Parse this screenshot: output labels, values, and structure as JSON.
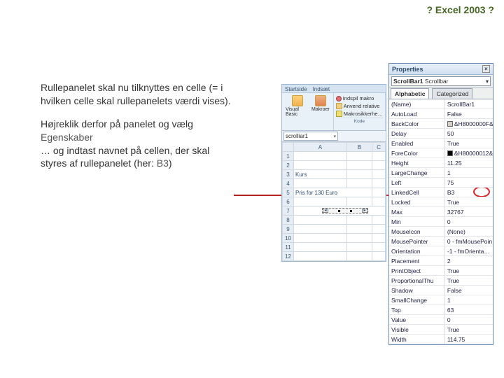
{
  "header": {
    "note": "? Excel 2003 ?"
  },
  "instructions": {
    "p1": "Rullepanelet skal nu tilknyttes en celle (= i hvilken celle skal rullepanelets værdi vises).",
    "p2a": "Højreklik derfor på panelet og vælg ",
    "p2b": "Egenskaber",
    "p3a": "… og indtast navnet på cellen, der skal styres af rullepanelet (her: ",
    "p3b": "B3",
    "p3c": ")"
  },
  "ribbon": {
    "tabs": [
      "Startside",
      "Indsæt"
    ],
    "vb": "Visual Basic",
    "mk": "Makroer",
    "rec": "Indspil makro",
    "rel": "Anvend relative",
    "sec": "Makrosikkerhe…",
    "group": "Kode"
  },
  "namebox": "scrolliar1",
  "columns": [
    "A",
    "B",
    "C"
  ],
  "rows": [
    "1",
    "2",
    "3",
    "4",
    "5",
    "6",
    "7",
    "8",
    "9",
    "10",
    "11",
    "12"
  ],
  "cells": {
    "A3": "Kurs",
    "A5": "Pris for 130 Euro"
  },
  "properties": {
    "title": "Properties",
    "object": "ScrollBar1",
    "object_type": "Scrollbar",
    "tabs": [
      "Alphabetic",
      "Categorized"
    ],
    "rows": [
      {
        "k": "(Name)",
        "v": "ScrollBar1"
      },
      {
        "k": "AutoLoad",
        "v": "False"
      },
      {
        "k": "BackColor",
        "v": "&H8000000F&",
        "sw": "#d4d0c8"
      },
      {
        "k": "Delay",
        "v": "50"
      },
      {
        "k": "Enabled",
        "v": "True"
      },
      {
        "k": "ForeColor",
        "v": "&H80000012&",
        "sw": "#000000"
      },
      {
        "k": "Height",
        "v": "11.25"
      },
      {
        "k": "LargeChange",
        "v": "1"
      },
      {
        "k": "Left",
        "v": "75"
      },
      {
        "k": "LinkedCell",
        "v": "B3",
        "hl": true
      },
      {
        "k": "Locked",
        "v": "True"
      },
      {
        "k": "Max",
        "v": "32767"
      },
      {
        "k": "Min",
        "v": "0"
      },
      {
        "k": "MouseIcon",
        "v": "(None)"
      },
      {
        "k": "MousePointer",
        "v": "0 - fmMousePoin"
      },
      {
        "k": "Orientation",
        "v": "-1 - fmOrienta…"
      },
      {
        "k": "Placement",
        "v": "2"
      },
      {
        "k": "PrintObject",
        "v": "True"
      },
      {
        "k": "ProportionalThu",
        "v": "True"
      },
      {
        "k": "Shadow",
        "v": "False"
      },
      {
        "k": "SmallChange",
        "v": "1"
      },
      {
        "k": "Top",
        "v": "63"
      },
      {
        "k": "Value",
        "v": "0"
      },
      {
        "k": "Visible",
        "v": "True"
      },
      {
        "k": "Width",
        "v": "114.75"
      }
    ]
  }
}
